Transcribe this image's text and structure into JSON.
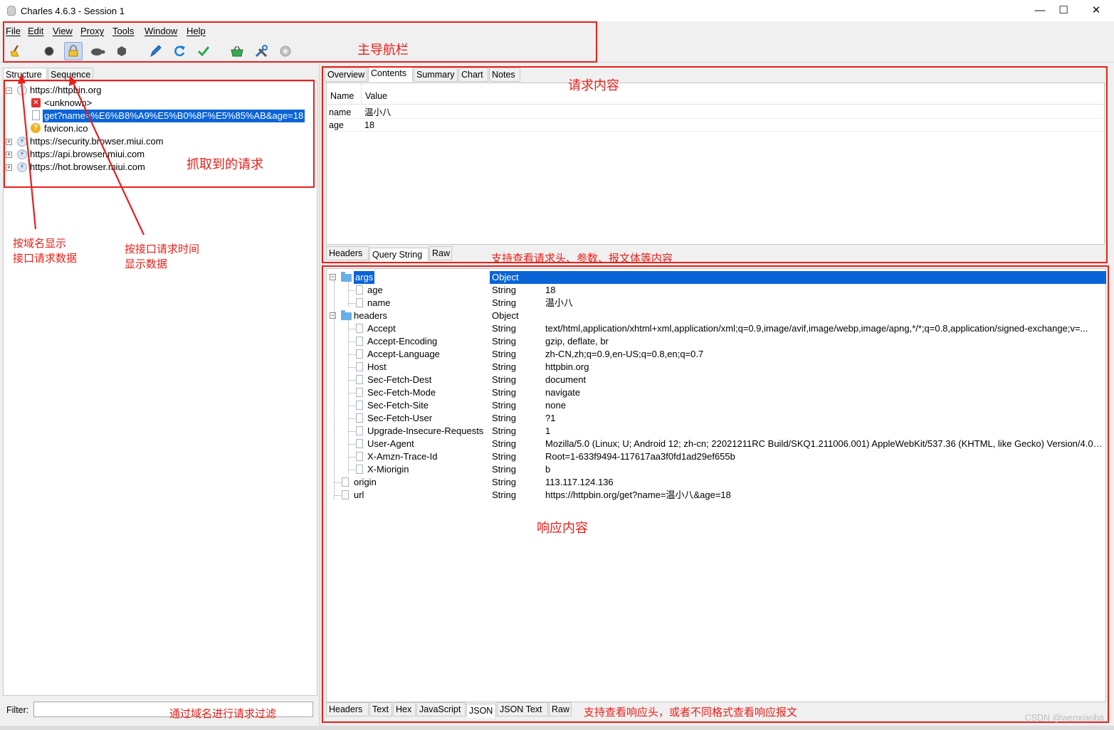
{
  "window": {
    "title": "Charles 4.6.3 - Session 1",
    "controls": [
      "—",
      "☐",
      "✕"
    ]
  },
  "menu": [
    "File",
    "Edit",
    "View",
    "Proxy",
    "Tools",
    "Window",
    "Help"
  ],
  "toolbar": {
    "icons": [
      "broom-icon",
      "record-icon",
      "ssl-proxy-icon",
      "throttle-turtle-icon",
      "breakpoint-hexagon-icon",
      "compose-pen-icon",
      "repeat-icon",
      "validate-check-icon",
      "basket-icon",
      "tools-icon",
      "settings-gear-icon"
    ]
  },
  "left": {
    "tabs": [
      "Structure",
      "Sequence"
    ],
    "tree": [
      {
        "label": "https://httpbin.org",
        "level": 0,
        "expander": "−",
        "icon": "globe"
      },
      {
        "label": "<unknown>",
        "level": 1,
        "icon": "error"
      },
      {
        "label": "get?name=%E6%B8%A9%E5%B0%8F%E5%85%AB&age=18",
        "level": 1,
        "icon": "doc",
        "selected": true
      },
      {
        "label": "favicon.ico",
        "level": 1,
        "icon": "question"
      },
      {
        "label": "https://security.browser.miui.com",
        "level": 0,
        "expander": "+",
        "icon": "bolt"
      },
      {
        "label": "https://api.browser.miui.com",
        "level": 0,
        "expander": "+",
        "icon": "bolt"
      },
      {
        "label": "https://hot.browser.miui.com",
        "level": 0,
        "expander": "+",
        "icon": "bolt"
      }
    ],
    "filter_label": "Filter:",
    "filter_value": ""
  },
  "request": {
    "tabs": [
      "Overview",
      "Contents",
      "Summary",
      "Chart",
      "Notes"
    ],
    "columns": [
      "Name",
      "Value"
    ],
    "rows": [
      {
        "name": "name",
        "value": "温小八"
      },
      {
        "name": "age",
        "value": "18"
      }
    ],
    "bottom_tabs": [
      "Headers",
      "Query String",
      "Raw"
    ]
  },
  "response": {
    "rows": [
      {
        "key": "args",
        "type": "Object",
        "value": "",
        "depth": 0,
        "kind": "folder",
        "expander": "−",
        "selected": true
      },
      {
        "key": "age",
        "type": "String",
        "value": "18",
        "depth": 1,
        "kind": "file"
      },
      {
        "key": "name",
        "type": "String",
        "value": "温小八",
        "depth": 1,
        "kind": "file"
      },
      {
        "key": "headers",
        "type": "Object",
        "value": "",
        "depth": 0,
        "kind": "folder",
        "expander": "−"
      },
      {
        "key": "Accept",
        "type": "String",
        "value": "text/html,application/xhtml+xml,application/xml;q=0.9,image/avif,image/webp,image/apng,*/*;q=0.8,application/signed-exchange;v=...",
        "depth": 1,
        "kind": "file"
      },
      {
        "key": "Accept-Encoding",
        "type": "String",
        "value": "gzip, deflate, br",
        "depth": 1,
        "kind": "file"
      },
      {
        "key": "Accept-Language",
        "type": "String",
        "value": "zh-CN,zh;q=0.9,en-US;q=0.8,en;q=0.7",
        "depth": 1,
        "kind": "file"
      },
      {
        "key": "Host",
        "type": "String",
        "value": "httpbin.org",
        "depth": 1,
        "kind": "file"
      },
      {
        "key": "Sec-Fetch-Dest",
        "type": "String",
        "value": "document",
        "depth": 1,
        "kind": "file"
      },
      {
        "key": "Sec-Fetch-Mode",
        "type": "String",
        "value": "navigate",
        "depth": 1,
        "kind": "file"
      },
      {
        "key": "Sec-Fetch-Site",
        "type": "String",
        "value": "none",
        "depth": 1,
        "kind": "file"
      },
      {
        "key": "Sec-Fetch-User",
        "type": "String",
        "value": "?1",
        "depth": 1,
        "kind": "file"
      },
      {
        "key": "Upgrade-Insecure-Requests",
        "type": "String",
        "value": "1",
        "depth": 1,
        "kind": "file"
      },
      {
        "key": "User-Agent",
        "type": "String",
        "value": "Mozilla/5.0 (Linux; U; Android 12; zh-cn; 22021211RC Build/SKQ1.211006.001) AppleWebKit/537.36 (KHTML, like Gecko) Version/4.0 C...",
        "depth": 1,
        "kind": "file"
      },
      {
        "key": "X-Amzn-Trace-Id",
        "type": "String",
        "value": "Root=1-633f9494-117617aa3f0fd1ad29ef655b",
        "depth": 1,
        "kind": "file"
      },
      {
        "key": "X-Miorigin",
        "type": "String",
        "value": "b",
        "depth": 1,
        "kind": "file"
      },
      {
        "key": "origin",
        "type": "String",
        "value": "113.117.124.136",
        "depth": 0,
        "kind": "file"
      },
      {
        "key": "url",
        "type": "String",
        "value": "https://httpbin.org/get?name=温小八&age=18",
        "depth": 0,
        "kind": "file"
      }
    ],
    "bottom_tabs": [
      "Headers",
      "Text",
      "Hex",
      "JavaScript",
      "JSON",
      "JSON Text",
      "Raw"
    ]
  },
  "annotations": {
    "nav": "主导航栏",
    "requests": "抓取到的请求",
    "by_domain_1": "按域名显示",
    "by_domain_2": "接口请求数据",
    "by_time_1": "按接口请求时间",
    "by_time_2": "显示数据",
    "request_content": "请求内容",
    "request_support": "支持查看请求头、参数、报文体等内容",
    "response_content": "响应内容",
    "response_support": "支持查看响应头，或者不同格式查看响应报文",
    "filter_hint": "通过域名进行请求过滤",
    "color": "#e8201a"
  },
  "watermark": "CSDN @wenxiaoba"
}
